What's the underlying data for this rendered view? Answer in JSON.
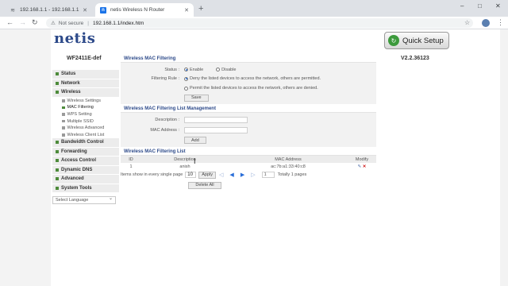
{
  "browser": {
    "tabs": [
      {
        "title": "192.168.1.1 - 192.168.1.1 Login A",
        "active": false,
        "icon": "wifi-icon"
      },
      {
        "title": "netis Wireless N Router",
        "active": true,
        "icon": "netis-favicon"
      }
    ],
    "new_tab": "+",
    "security": "Not secure",
    "url": "192.168.1.1/index.htm",
    "window_controls": [
      "–",
      "□",
      "✕"
    ]
  },
  "header": {
    "logo": "netis",
    "quick_setup": "Quick Setup",
    "model": "WF2411E-def",
    "version": "V2.2.36123"
  },
  "sidebar": {
    "items": [
      {
        "label": "Status",
        "type": "main"
      },
      {
        "label": "Network",
        "type": "main"
      },
      {
        "label": "Wireless",
        "type": "main"
      },
      {
        "label": "Wireless Settings",
        "type": "sub"
      },
      {
        "label": "MAC Filtering",
        "type": "sub",
        "selected": true
      },
      {
        "label": "WPS Setting",
        "type": "sub"
      },
      {
        "label": "Multiple SSID",
        "type": "sub"
      },
      {
        "label": "Wireless Advanced",
        "type": "sub"
      },
      {
        "label": "Wireless Client List",
        "type": "sub"
      },
      {
        "label": "Bandwidth Control",
        "type": "main"
      },
      {
        "label": "Forwarding",
        "type": "main"
      },
      {
        "label": "Access Control",
        "type": "main"
      },
      {
        "label": "Dynamic DNS",
        "type": "main"
      },
      {
        "label": "Advanced",
        "type": "main"
      },
      {
        "label": "System Tools",
        "type": "main"
      }
    ],
    "language": "Select Language"
  },
  "filtering": {
    "title": "Wireless MAC Filtering",
    "status_label": "Status :",
    "enable": "Enable",
    "disable": "Disable",
    "rule_label": "Filtering Rule :",
    "rule_allow": "Deny the listed devices to access the network, others are permitted.",
    "rule_deny": "Permit the listed devices to access the network, others are denied.",
    "save": "Save"
  },
  "management": {
    "title": "Wireless MAC Filtering List Management",
    "description_label": "Description :",
    "mac_label": "MAC Address :",
    "add": "Add"
  },
  "list": {
    "title": "Wireless MAC Filtering List",
    "headers": [
      "ID",
      "Description",
      "MAC Address",
      "Modify"
    ],
    "rows": [
      {
        "id": "1",
        "description": "anish",
        "mac": "ac:7b:a1:33:40:c8"
      }
    ],
    "per_page_label": "Items show in every single page",
    "per_page": "10",
    "apply": "Apply",
    "page": "1",
    "total": "Totally 1 pages",
    "delete_all": "Delete All"
  }
}
